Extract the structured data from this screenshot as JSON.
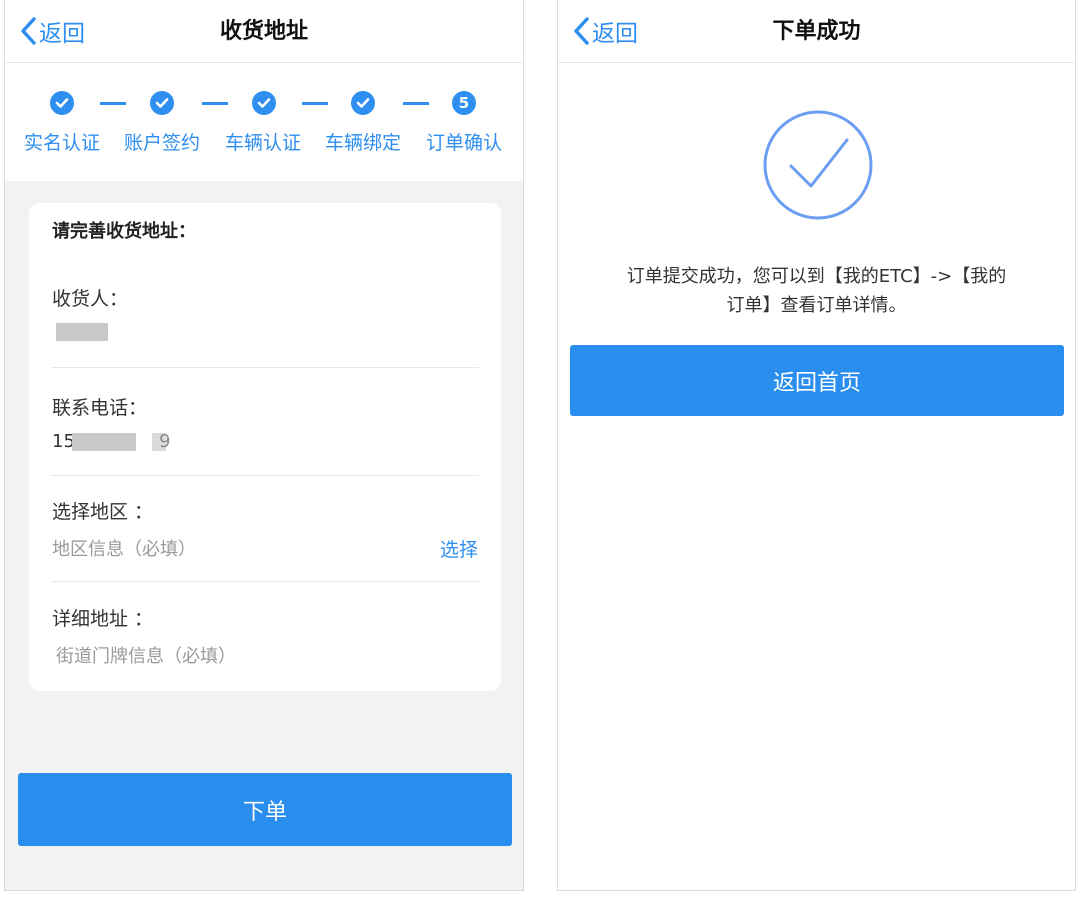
{
  "left_screen": {
    "nav": {
      "back_label": "返回",
      "title": "收货地址"
    },
    "steps": [
      {
        "label": "实名认证",
        "state": "done",
        "icon": "check-icon"
      },
      {
        "label": "账户签约",
        "state": "done",
        "icon": "check-icon"
      },
      {
        "label": "车辆认证",
        "state": "done",
        "icon": "check-icon"
      },
      {
        "label": "车辆绑定",
        "state": "done",
        "icon": "check-icon"
      },
      {
        "label": "订单确认",
        "state": "current",
        "number": "5"
      }
    ],
    "form": {
      "title": "请完善收货地址：",
      "recipient_label": "收货人：",
      "phone_label": "联系电话：",
      "phone_prefix": "15",
      "phone_suffix": "9",
      "region_label": "选择地区 ：",
      "region_placeholder": "地区信息（必填）",
      "region_action": "选择",
      "address_label": "详细地址 ：",
      "address_placeholder": "街道门牌信息（必填）"
    },
    "submit_label": "下单"
  },
  "right_screen": {
    "nav": {
      "back_label": "返回",
      "title": "下单成功"
    },
    "success_icon": "check-circle-icon",
    "message_line1": "订单提交成功，您可以到【我的ETC】->【我的",
    "message_line2": "订单】查看订单详情。",
    "home_button_label": "返回首页"
  },
  "colors": {
    "accent": "#2f8ff0",
    "button": "#2a8eee",
    "page_bg": "#f2f2f2",
    "circle": "#6b9df2"
  }
}
